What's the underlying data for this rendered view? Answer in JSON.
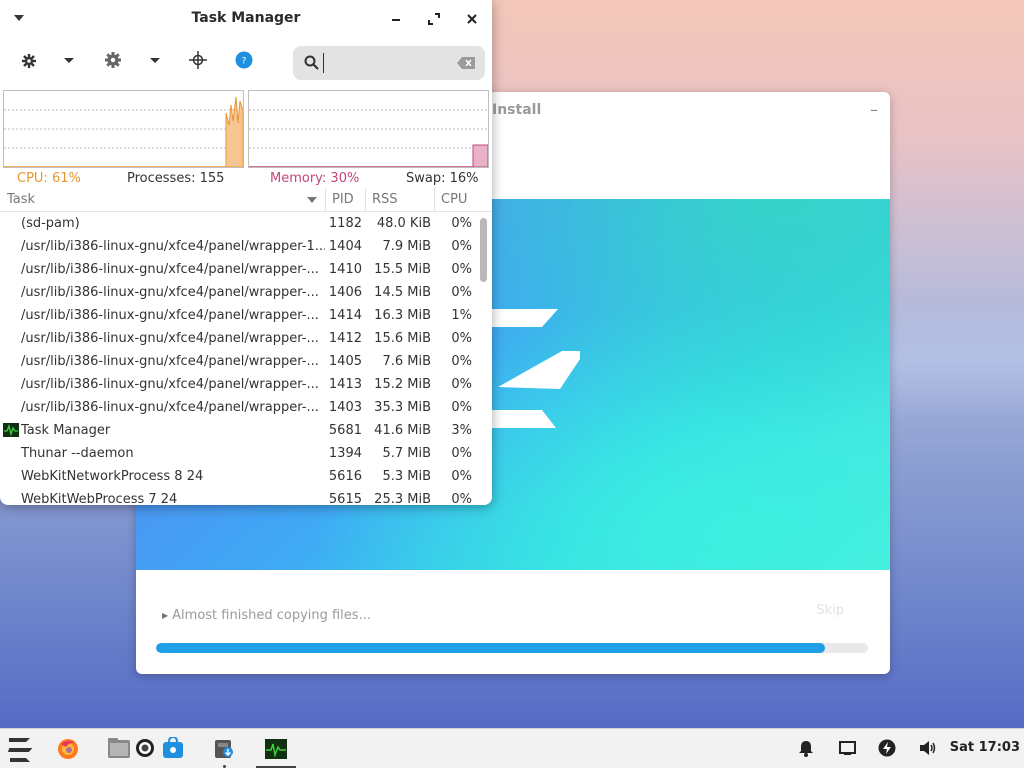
{
  "desktop": {
    "installer": {
      "title": "Install",
      "status_text": "Almost finished copying files...",
      "skip_label": "Skip",
      "progress": 0.94
    },
    "task_manager": {
      "title": "Task Manager",
      "search": {
        "value": "",
        "placeholder": ""
      },
      "stats": {
        "cpu": "CPU: 61%",
        "processes": "Processes: 155",
        "memory": "Memory: 30%",
        "swap": "Swap: 16%"
      },
      "colors": {
        "cpu": "#e8962e",
        "memory": "#c0467a"
      },
      "columns": {
        "task": "Task",
        "pid": "PID",
        "rss": "RSS",
        "cpu": "CPU"
      },
      "rows": [
        {
          "task": "(sd-pam)",
          "pid": "1182",
          "rss": "48.0 KiB",
          "cpu": "0%"
        },
        {
          "task": "/usr/lib/i386-linux-gnu/xfce4/panel/wrapper-1...",
          "pid": "1404",
          "rss": "7.9 MiB",
          "cpu": "0%"
        },
        {
          "task": "/usr/lib/i386-linux-gnu/xfce4/panel/wrapper-...",
          "pid": "1410",
          "rss": "15.5 MiB",
          "cpu": "0%"
        },
        {
          "task": "/usr/lib/i386-linux-gnu/xfce4/panel/wrapper-...",
          "pid": "1406",
          "rss": "14.5 MiB",
          "cpu": "0%"
        },
        {
          "task": "/usr/lib/i386-linux-gnu/xfce4/panel/wrapper-...",
          "pid": "1414",
          "rss": "16.3 MiB",
          "cpu": "1%"
        },
        {
          "task": "/usr/lib/i386-linux-gnu/xfce4/panel/wrapper-...",
          "pid": "1412",
          "rss": "15.6 MiB",
          "cpu": "0%"
        },
        {
          "task": "/usr/lib/i386-linux-gnu/xfce4/panel/wrapper-...",
          "pid": "1405",
          "rss": "7.6 MiB",
          "cpu": "0%"
        },
        {
          "task": "/usr/lib/i386-linux-gnu/xfce4/panel/wrapper-...",
          "pid": "1413",
          "rss": "15.2 MiB",
          "cpu": "0%"
        },
        {
          "task": "/usr/lib/i386-linux-gnu/xfce4/panel/wrapper-...",
          "pid": "1403",
          "rss": "35.3 MiB",
          "cpu": "0%"
        },
        {
          "task": "Task Manager",
          "pid": "5681",
          "rss": "41.6 MiB",
          "cpu": "3%",
          "icon": "task-manager-icon"
        },
        {
          "task": "Thunar --daemon",
          "pid": "1394",
          "rss": "5.7 MiB",
          "cpu": "0%"
        },
        {
          "task": "WebKitNetworkProcess 8 24",
          "pid": "5616",
          "rss": "5.3 MiB",
          "cpu": "0%"
        },
        {
          "task": "WebKitWebProcess 7 24",
          "pid": "5615",
          "rss": "25.3 MiB",
          "cpu": "0%"
        }
      ]
    }
  },
  "taskbar": {
    "clock": "Sat 17:03",
    "items": [
      "zorin-menu-icon",
      "firefox-icon",
      "files-icon",
      "web-icon",
      "software-store-icon",
      "installer-icon",
      "task-manager-icon"
    ],
    "tray": [
      "notifications-icon",
      "display-icon",
      "power-icon",
      "volume-icon"
    ]
  }
}
